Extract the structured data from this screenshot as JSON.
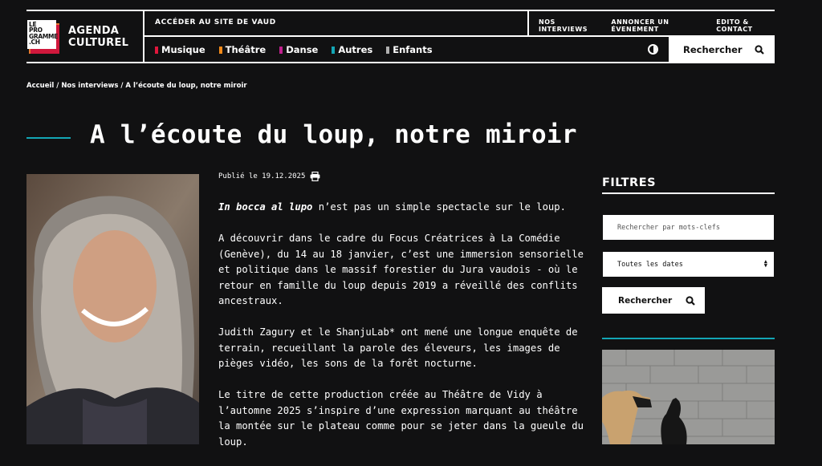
{
  "logo": {
    "line1": "LE",
    "line2": "PRO",
    "line3": "GRAMME",
    "line4": ".CH",
    "name_line1": "AGENDA",
    "name_line2": "CULTUREL"
  },
  "header": {
    "vaud_link": "ACCÉDER AU SITE DE VAUD",
    "top_links": [
      "NOS INTERVIEWS",
      "ANNONCER UN ÉVENEMENT",
      "EDITO & CONTACT"
    ],
    "categories": [
      {
        "label": "Musique",
        "color": "#e0173c"
      },
      {
        "label": "Théâtre",
        "color": "#f28a1a"
      },
      {
        "label": "Danse",
        "color": "#c0208e"
      },
      {
        "label": "Autres",
        "color": "#13a6b5"
      },
      {
        "label": "Enfants",
        "color": "#b0b0b0"
      }
    ],
    "search_label": "Rechercher"
  },
  "breadcrumb": "Accueil / Nos interviews / A l’écoute du loup, notre miroir",
  "title": "A l’écoute du loup, notre miroir",
  "published": "Publié le 19.12.2025",
  "article": {
    "p1_em": "In bocca al lupo",
    "p1_rest": " n’est pas un simple spectacle sur le loup.",
    "p2": "A découvrir dans le cadre du Focus Créatrices à La Comédie (Genève), du 14 au 18 janvier, c’est une immersion sensorielle et politique dans le massif forestier du Jura vaudois - où le retour en famille du loup depuis 2019 a réveillé des conflits ancestraux.",
    "p3": "Judith Zagury et le ShanjuLab* ont mené une longue enquête de terrain, recueillant la parole des éleveurs, les images de pièges vidéo, les sons de la forêt nocturne.",
    "p4": "Le titre de cette production créée au Théâtre de Vidy à l’automne 2025 s’inspire d’une expression marquant au théâtre la montée sur le plateau comme pour se jeter dans la gueule du loup."
  },
  "filters": {
    "title": "FILTRES",
    "keyword_placeholder": "Rechercher par mots-clefs",
    "date_value": "Toutes les dates",
    "search_label": "Rechercher"
  }
}
